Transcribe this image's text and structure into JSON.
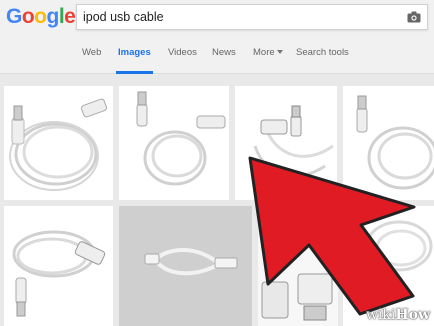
{
  "logo": {
    "letters": [
      "G",
      "o",
      "o",
      "g",
      "l",
      "e"
    ],
    "colors": [
      "#4285f4",
      "#ea4335",
      "#fbbc05",
      "#4285f4",
      "#34a853",
      "#ea4335"
    ]
  },
  "search": {
    "value": "ipod usb cable",
    "placeholder": ""
  },
  "tabs": [
    {
      "label": "Web",
      "active": false
    },
    {
      "label": "Images",
      "active": true
    },
    {
      "label": "Videos",
      "active": false
    },
    {
      "label": "News",
      "active": false
    },
    {
      "label": "More",
      "active": false
    },
    {
      "label": "Search tools",
      "active": false
    }
  ],
  "results": [
    {
      "alt": "white ipod usb cable coiled"
    },
    {
      "alt": "ipod cable with usb and dock connector"
    },
    {
      "alt": "ipod usb cable plugs"
    },
    {
      "alt": "coiled white usb cable"
    },
    {
      "alt": "coiled ipod cable"
    },
    {
      "alt": "short usb cable on grey background"
    },
    {
      "alt": "usb cable plugs close-up"
    },
    {
      "alt": "coiled cable partially hidden"
    }
  ],
  "colors": {
    "accent": "#1a73e8",
    "arrow": "#e01b24",
    "arrow_outline": "#222222"
  },
  "watermark": {
    "prefix": "wiki",
    "suffix": "How"
  }
}
